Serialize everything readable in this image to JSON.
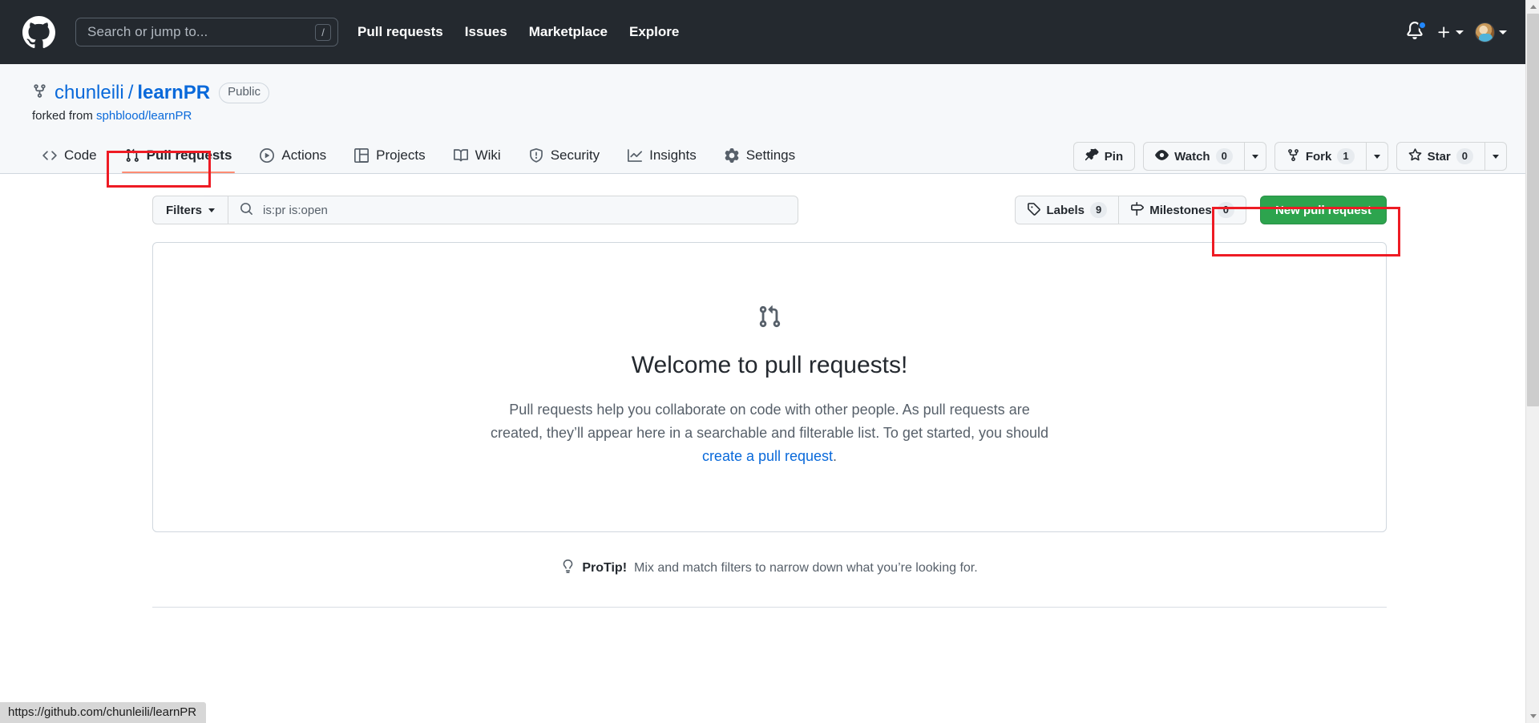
{
  "header": {
    "logo_icon": "github-logo-icon",
    "search": {
      "placeholder": "Search or jump to...",
      "shortcut_key": "/"
    },
    "nav": [
      {
        "label": "Pull requests"
      },
      {
        "label": "Issues"
      },
      {
        "label": "Marketplace"
      },
      {
        "label": "Explore"
      }
    ],
    "notifications_icon": "bell-icon",
    "has_unread_notifications": true,
    "create_new_icon": "plus-icon",
    "avatar_icon": "user-avatar"
  },
  "repo": {
    "fork_icon": "repo-forked-icon",
    "owner": "chunleili",
    "separator": "/",
    "name": "learnPR",
    "visibility": "Public",
    "forked_from_label": "forked from",
    "forked_from_repo": "sphblood/learnPR",
    "actions": {
      "pin": {
        "label": "Pin",
        "icon": "pin-icon"
      },
      "watch": {
        "label": "Watch",
        "count": "0",
        "icon": "eye-icon"
      },
      "fork": {
        "label": "Fork",
        "count": "1",
        "icon": "repo-forked-icon"
      },
      "star": {
        "label": "Star",
        "count": "0",
        "icon": "star-icon"
      }
    }
  },
  "tabs": [
    {
      "label": "Code",
      "icon": "code-icon",
      "active": false
    },
    {
      "label": "Pull requests",
      "icon": "git-pull-request-icon",
      "active": true
    },
    {
      "label": "Actions",
      "icon": "play-icon",
      "active": false
    },
    {
      "label": "Projects",
      "icon": "table-icon",
      "active": false
    },
    {
      "label": "Wiki",
      "icon": "book-icon",
      "active": false
    },
    {
      "label": "Security",
      "icon": "shield-icon",
      "active": false
    },
    {
      "label": "Insights",
      "icon": "graph-icon",
      "active": false
    },
    {
      "label": "Settings",
      "icon": "gear-icon",
      "active": false
    }
  ],
  "filter_bar": {
    "filters_label": "Filters",
    "search_icon": "search-icon",
    "search_value": "is:pr is:open",
    "labels": {
      "label": "Labels",
      "count": "9",
      "icon": "tag-icon"
    },
    "milestones": {
      "label": "Milestones",
      "count": "0",
      "icon": "milestone-icon"
    },
    "new_pull_request": "New pull request"
  },
  "blankslate": {
    "icon": "git-pull-request-icon",
    "title": "Welcome to pull requests!",
    "body_part1": "Pull requests help you collaborate on code with other people. As pull requests are created, they’ll appear here in a searchable and filterable list. To get started, you should ",
    "body_link": "create a pull request",
    "body_part2": "."
  },
  "protip": {
    "icon": "lightbulb-icon",
    "label": "ProTip!",
    "text": "Mix and match filters to narrow down what you’re looking for."
  },
  "status_bar": {
    "url": "https://github.com/chunleili/learnPR"
  },
  "colors": {
    "header_bg": "#24292f",
    "accent_link": "#0969da",
    "green_button": "#2da44e",
    "active_tab_underline": "#fd8c73",
    "annotation": "#ee1b24"
  }
}
